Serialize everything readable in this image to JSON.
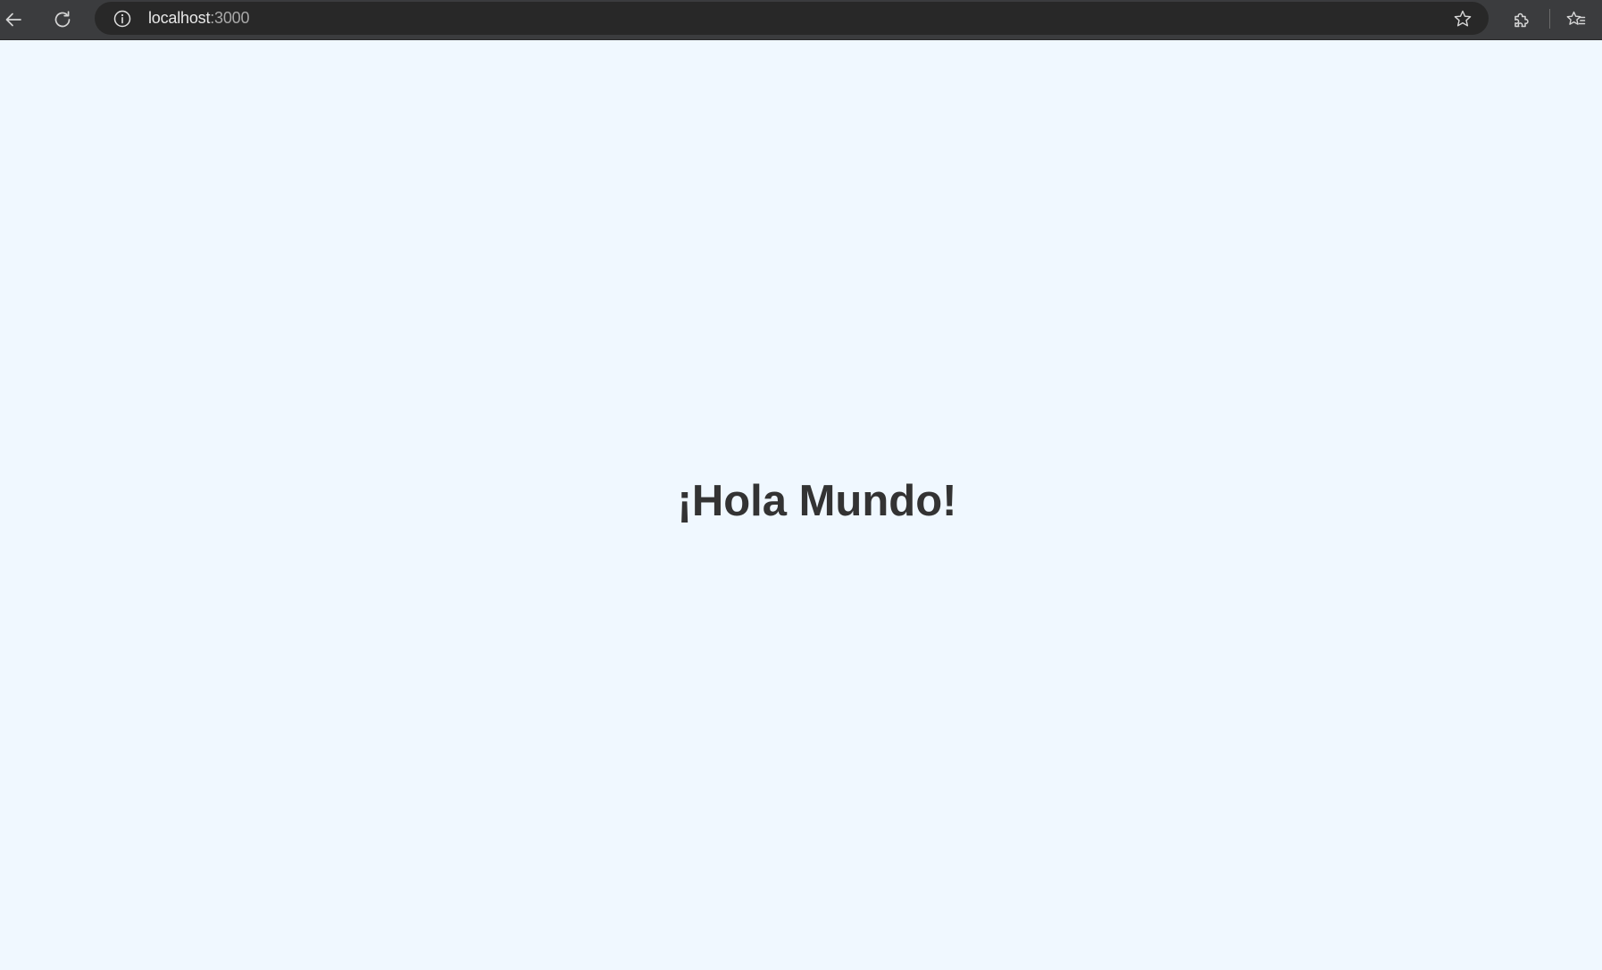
{
  "toolbar": {
    "back_icon": "back-arrow-icon",
    "reload_icon": "reload-icon",
    "site_info_icon": "info-icon",
    "address": {
      "host": "localhost",
      "port": ":3000"
    },
    "bookmark_icon": "star-icon",
    "extensions_icon": "puzzle-icon",
    "favorites_icon": "favorites-icon"
  },
  "page": {
    "heading": "¡Hola Mundo!"
  },
  "colors": {
    "page_background": "#f0f8ff",
    "heading_text": "#333333",
    "toolbar_background": "#3b3c3e",
    "omnibox_background": "#282828"
  }
}
